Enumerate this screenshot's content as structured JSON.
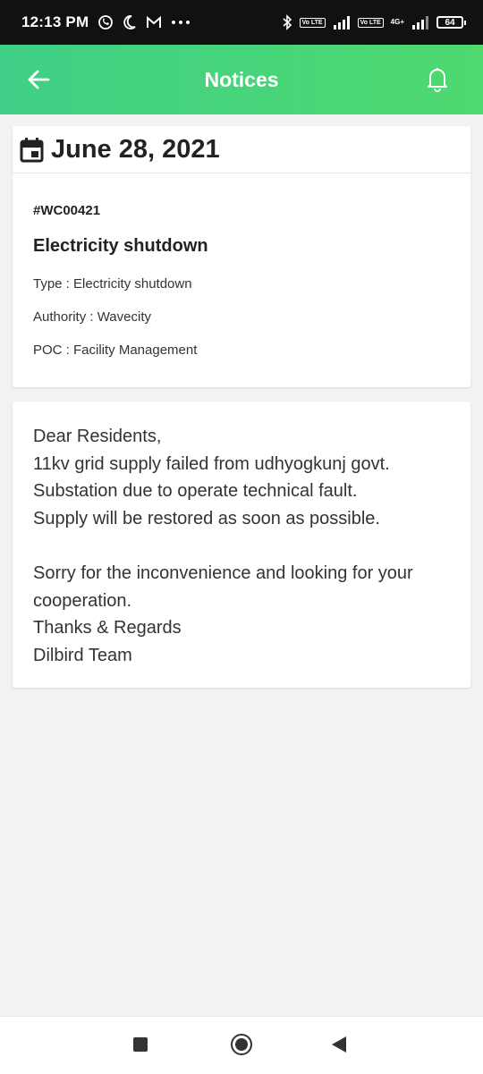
{
  "status_bar": {
    "time": "12:13 PM",
    "battery": "64",
    "volte_1": "Vo LTE",
    "volte_2": "Vo LTE",
    "net_label": "4G+",
    "left_icons": [
      "whatsapp-icon",
      "moon-icon",
      "gmail-icon",
      "more-dots-icon"
    ],
    "right_icons": [
      "bluetooth-icon",
      "signal-icon",
      "signal-icon",
      "battery-icon"
    ]
  },
  "app_bar": {
    "title": "Notices",
    "back_icon": "arrow-left-icon",
    "bell_icon": "bell-icon",
    "color_start": "#3fcf86",
    "color_end": "#4fd96f"
  },
  "notice": {
    "date": "June 28, 2021",
    "date_icon": "calendar-icon",
    "id": "#WC00421",
    "title": "Electricity shutdown",
    "type_line": "Type : Electricity shutdown",
    "authority_line": "Authority : Wavecity",
    "poc_line": "POC : Facility Management"
  },
  "message": {
    "lines": [
      "Dear Residents,",
      "11kv grid supply failed from udhyogkunj govt.",
      "Substation due to operate  technical fault.",
      "Supply will be restored as soon as possible.",
      "",
      "Sorry for the inconvenience and looking for your",
      "cooperation.",
      "Thanks & Regards",
      "Dilbird Team"
    ]
  },
  "nav_bar": {
    "icons": [
      "recent-apps-icon",
      "home-icon",
      "back-icon"
    ]
  }
}
